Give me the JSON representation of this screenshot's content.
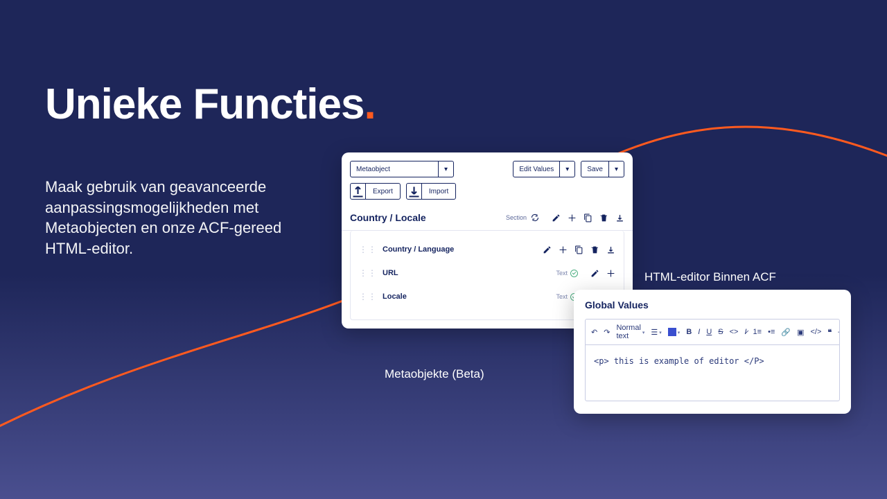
{
  "heading": {
    "main": "Unieke Functies",
    "dot": "."
  },
  "subtext": "Maak gebruik van geavanceerde aanpassingsmogelijkheden met Metaobjecten en onze ACF-gereed HTML-editor.",
  "captions": {
    "metaobject": "Metaobjekte (Beta)",
    "htmleditor": "HTML-editor Binnen ACF"
  },
  "panel": {
    "dropdown_metaobject": "Metaobject",
    "btn_edit_values": "Edit Values",
    "btn_save": "Save",
    "btn_export": "Export",
    "btn_import": "Import",
    "section_title": "Country / Locale",
    "section_label": "Section",
    "fields": [
      {
        "name": "Country / Language",
        "type": "",
        "icons": "full"
      },
      {
        "name": "URL",
        "type": "Text",
        "icons": "min"
      },
      {
        "name": "Locale",
        "type": "Text",
        "icons": "min"
      }
    ]
  },
  "editor": {
    "title": "Global Values",
    "format_label": "Normal text",
    "body": "<p> this is example of editor </P>"
  }
}
